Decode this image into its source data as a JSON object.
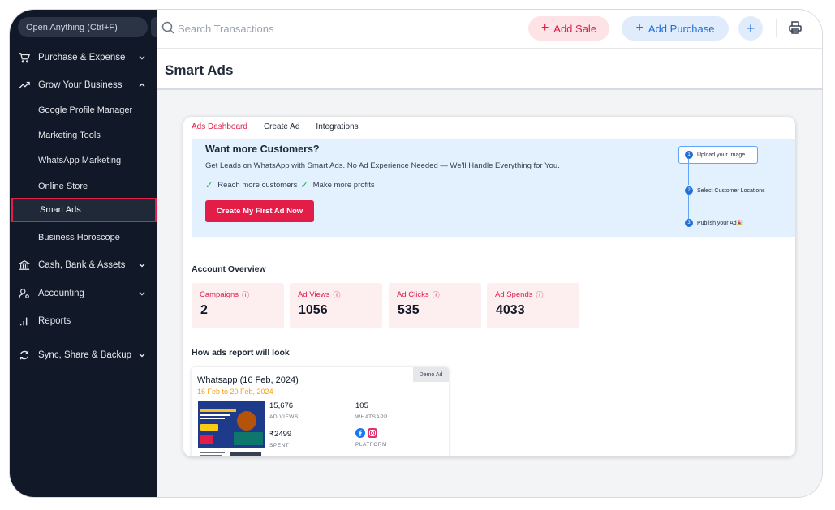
{
  "sidebar": {
    "search_label": "Open Anything (Ctrl+F)",
    "items": [
      {
        "label": "Purchase & Expense"
      },
      {
        "label": "Grow Your Business"
      },
      {
        "label": "Cash, Bank & Assets"
      },
      {
        "label": "Accounting"
      },
      {
        "label": "Reports"
      },
      {
        "label": "Sync, Share & Backup"
      }
    ],
    "sub_items": [
      {
        "label": "Google Profile Manager"
      },
      {
        "label": "Marketing Tools"
      },
      {
        "label": "WhatsApp Marketing"
      },
      {
        "label": "Online Store"
      },
      {
        "label": "Smart Ads"
      },
      {
        "label": "Business Horoscope"
      }
    ]
  },
  "topbar": {
    "search_placeholder": "Search Transactions",
    "add_sale": "Add Sale",
    "add_purchase": "Add Purchase",
    "plus": "+"
  },
  "page": {
    "title": "Smart Ads"
  },
  "tabs": [
    {
      "label": "Ads Dashboard",
      "active": true
    },
    {
      "label": "Create Ad"
    },
    {
      "label": "Integrations"
    }
  ],
  "banner": {
    "title": "Want more Customers?",
    "subtitle": "Get Leads on WhatsApp with Smart Ads. No Ad Experience Needed — We'll Handle Everything for You.",
    "check1": "Reach more customers",
    "check2": "Make more profits",
    "cta": "Create My First Ad Now",
    "steps": [
      {
        "num": "1",
        "label": "Upload your Image"
      },
      {
        "num": "2",
        "label": "Select Customer Locations"
      },
      {
        "num": "3",
        "label": "Publish your Ad🎉"
      }
    ]
  },
  "overview": {
    "title": "Account Overview",
    "stats": [
      {
        "label": "Campaigns",
        "value": "2"
      },
      {
        "label": "Ad Views",
        "value": "1056"
      },
      {
        "label": "Ad Clicks",
        "value": "535"
      },
      {
        "label": "Ad Spends",
        "value": "4033"
      }
    ]
  },
  "report": {
    "section_title": "How ads report will look",
    "badge": "Demo Ad",
    "title": "Whatsapp (16 Feb, 2024)",
    "date_range": "16 Feb to 20 Feb, 2024",
    "ad_views_value": "15,676",
    "ad_views_label": "AD VIEWS",
    "whatsapp_value": "105",
    "whatsapp_label": "WHATSAPP",
    "spent_value": "₹2499",
    "spent_label": "SPENT",
    "platform_label": "PLATFORM"
  },
  "colors": {
    "accent": "#e11d48",
    "blue": "#1e6fd9",
    "sidebar_bg": "#111827"
  }
}
